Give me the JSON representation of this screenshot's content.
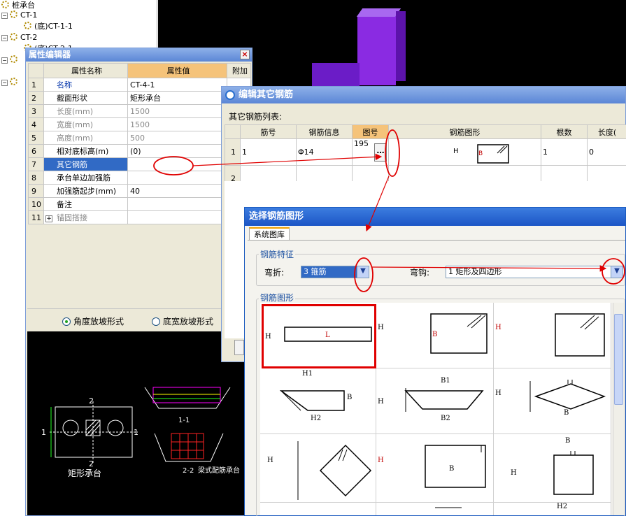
{
  "tree": {
    "root_label": "桩承台",
    "items": [
      {
        "label": "CT-1",
        "expand": "−"
      },
      {
        "label": "(底)CT-1-1"
      },
      {
        "label": "CT-2",
        "expand": "−"
      },
      {
        "label": "(底)CT-2-1"
      }
    ]
  },
  "prop_editor": {
    "title": "属性编辑器",
    "close": "×",
    "col_name": "属性名称",
    "col_value": "属性值",
    "col_extra": "附加",
    "rows": [
      {
        "n": "1",
        "name": "名称",
        "value": "CT-4-1"
      },
      {
        "n": "2",
        "name": "截面形状",
        "value": "矩形承台"
      },
      {
        "n": "3",
        "name": "长度(mm)",
        "value": "1500"
      },
      {
        "n": "4",
        "name": "宽度(mm)",
        "value": "1500"
      },
      {
        "n": "5",
        "name": "高度(mm)",
        "value": "500"
      },
      {
        "n": "6",
        "name": "相对底标高(m)",
        "value": "(0)"
      },
      {
        "n": "7",
        "name": "其它钢筋",
        "value": ""
      },
      {
        "n": "8",
        "name": "承台单边加强筋",
        "value": ""
      },
      {
        "n": "9",
        "name": "加强筋起步(mm)",
        "value": "40"
      },
      {
        "n": "10",
        "name": "备注",
        "value": ""
      },
      {
        "n": "11",
        "name": "锚固搭接",
        "value": "",
        "expand": "+"
      }
    ],
    "radio1": "角度放坡形式",
    "radio2": "底宽放坡形式",
    "drawing": {
      "label_plan": "矩形承台",
      "label_11": "1-1",
      "label_22": "2-2",
      "label_beam": "梁式配筋承台",
      "dim_1": "1",
      "dim_2": "2"
    }
  },
  "edit_rebar": {
    "title": "编辑其它钢筋",
    "list_label": "其它钢筋列表:",
    "headers": [
      "筋号",
      "钢筋信息",
      "图号",
      "钢筋图形",
      "根数",
      "长度("
    ],
    "rows": [
      {
        "n": "1",
        "bar_no": "1",
        "info": "Φ14",
        "fig_no": "195",
        "btn": "…",
        "shape_h": "H",
        "shape_b": "B",
        "count": "1",
        "length": "0"
      },
      {
        "n": "2"
      }
    ]
  },
  "select_shape": {
    "title": "选择钢筋图形",
    "tab": "系统图库",
    "feature_group": "钢筋特征",
    "bend_label": "弯折:",
    "bend_value": "3 箍筋",
    "hook_label": "弯钩:",
    "hook_value": "1 矩形及四边形",
    "shape_group": "钢筋图形",
    "shapes": {
      "s1": {
        "h": "H",
        "l": "L"
      },
      "s2": {
        "h": "H",
        "b": "B"
      },
      "s3": {
        "h": "H"
      },
      "s4": {
        "h1": "H1",
        "h2": "H2",
        "b": "B"
      },
      "s5": {
        "b1": "B1",
        "b2": "B2",
        "h": "H"
      },
      "s6": {
        "h": "H",
        "b": "B"
      },
      "s7": {
        "h": "H"
      },
      "s8": {
        "h": "H",
        "b": "B"
      },
      "s9": {
        "h": "H",
        "b": "B",
        "h2": "H2"
      }
    }
  },
  "colors": {
    "annotation": "#e00000",
    "selection": "#316ac5",
    "bar3d": "#7a1fd6"
  }
}
